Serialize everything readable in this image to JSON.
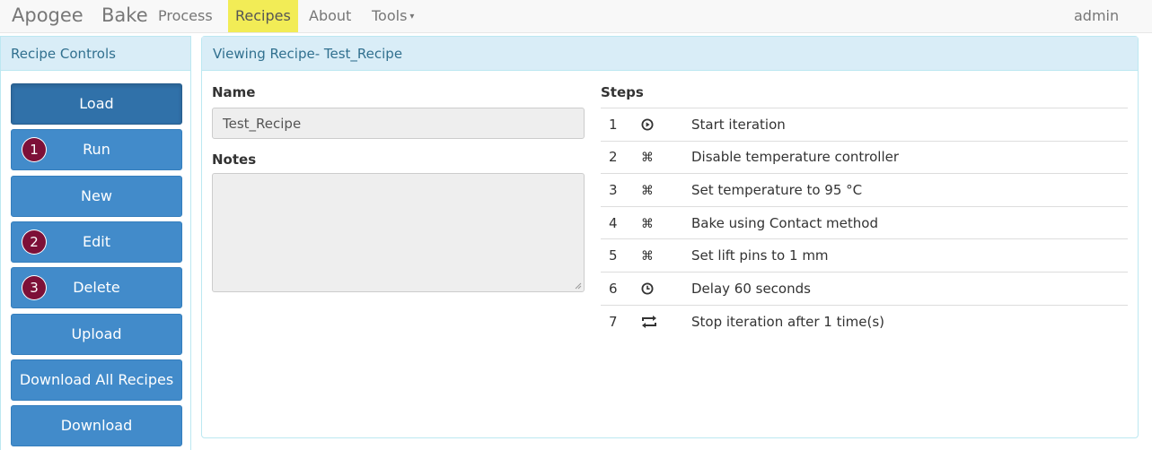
{
  "navbar": {
    "brand_first": "Apogee",
    "brand_second": "Bake",
    "items": [
      {
        "label": "Process"
      },
      {
        "label": "Recipes",
        "active": true,
        "highlight_color": "#f2ec56"
      },
      {
        "label": "About"
      },
      {
        "label": "Tools",
        "has_dropdown": true,
        "caret": "▾"
      }
    ],
    "user": "admin"
  },
  "sidebar": {
    "title": "Recipe Controls",
    "buttons": [
      {
        "label": "Load",
        "active": true
      },
      {
        "label": "Run",
        "badge": "1"
      },
      {
        "label": "New"
      },
      {
        "label": "Edit",
        "badge": "2"
      },
      {
        "label": "Delete",
        "badge": "3"
      },
      {
        "label": "Upload"
      },
      {
        "label": "Download All Recipes"
      },
      {
        "label": "Download"
      }
    ]
  },
  "main": {
    "title": "Viewing Recipe- Test_Recipe",
    "name_label": "Name",
    "name_value": "Test_Recipe",
    "notes_label": "Notes",
    "notes_value": "",
    "steps_label": "Steps",
    "steps": [
      {
        "num": "1",
        "icon": "play-circle-icon",
        "text": "Start iteration"
      },
      {
        "num": "2",
        "icon": "command-icon",
        "text": "Disable temperature controller"
      },
      {
        "num": "3",
        "icon": "command-icon",
        "text": "Set temperature to 95 °C"
      },
      {
        "num": "4",
        "icon": "command-icon",
        "text": "Bake using Contact method"
      },
      {
        "num": "5",
        "icon": "command-icon",
        "text": "Set lift pins to 1 mm"
      },
      {
        "num": "6",
        "icon": "clock-icon",
        "text": "Delay 60 seconds"
      },
      {
        "num": "7",
        "icon": "repeat-icon",
        "text": "Stop iteration after 1 time(s)"
      }
    ]
  },
  "colors": {
    "primary_button": "#428bca",
    "active_button": "#3071a9",
    "panel_header_bg": "#d9edf7",
    "panel_header_text": "#31708f",
    "badge": "#7d1038"
  }
}
